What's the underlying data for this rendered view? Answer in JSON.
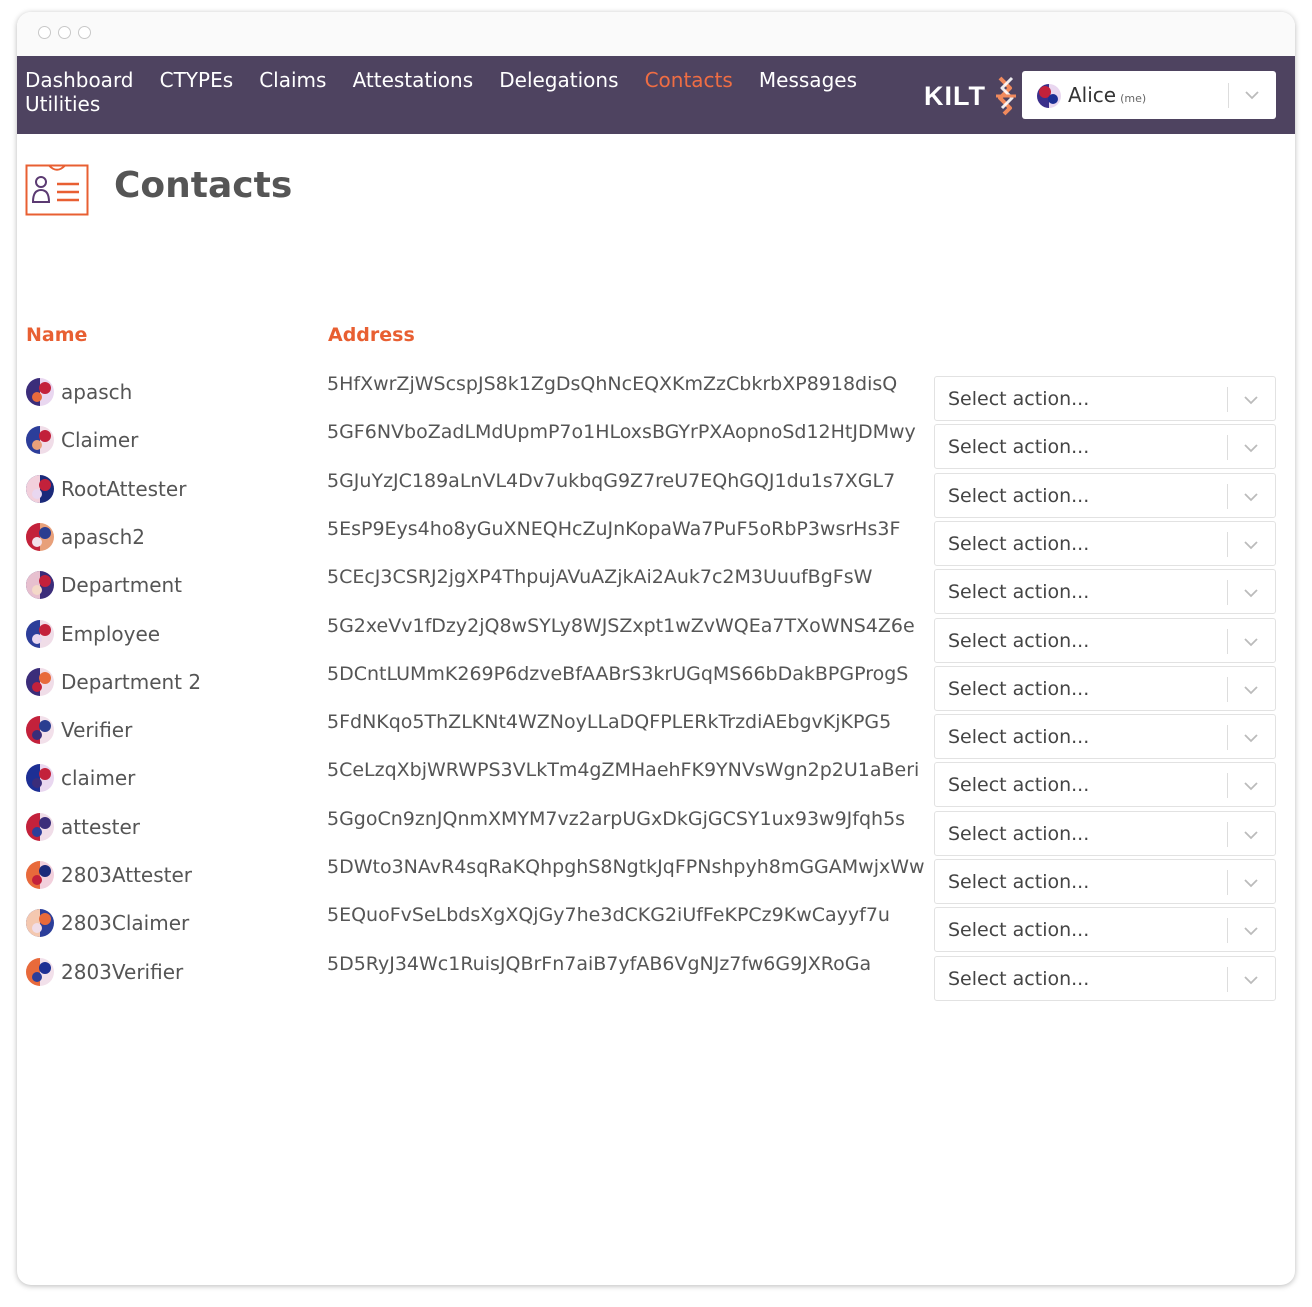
{
  "nav": {
    "links": [
      "Dashboard",
      "CTYPEs",
      "Claims",
      "Attestations",
      "Delegations",
      "Contacts",
      "Messages",
      "Utilities"
    ],
    "active": "Contacts",
    "logo_text": "KILT",
    "user": {
      "name": "Alice",
      "suffix": "(me)"
    }
  },
  "page": {
    "title": "Contacts"
  },
  "table": {
    "headers": {
      "name": "Name",
      "address": "Address"
    },
    "action_placeholder": "Select action...",
    "rows": [
      {
        "name": "apasch",
        "address": "5HfXwrZjWScspJS8k1ZgDsQhNcEQXKmZzCbkrbXP8918disQ"
      },
      {
        "name": "Claimer",
        "address": "5GF6NVboZadLMdUpmP7o1HLoxsBGYrPXAopnoSd12HtJDMwy"
      },
      {
        "name": "RootAttester",
        "address": "5GJuYzJC189aLnVL4Dv7ukbqG9Z7reU7EQhGQJ1du1s7XGL7"
      },
      {
        "name": "apasch2",
        "address": "5EsP9Eys4ho8yGuXNEQHcZuJnKopaWa7PuF5oRbP3wsrHs3F"
      },
      {
        "name": "Department",
        "address": "5CEcJ3CSRJ2jgXP4ThpujAVuAZjkAi2Auk7c2M3UuufBgFsW"
      },
      {
        "name": "Employee",
        "address": "5G2xeVv1fDzy2jQ8wSYLy8WJSZxpt1wZvWQEa7TXoWNS4Z6e"
      },
      {
        "name": "Department 2",
        "address": "5DCntLUMmK269P6dzveBfAABrS3krUGqMS66bDakBPGProgS"
      },
      {
        "name": "Verifier",
        "address": "5FdNKqo5ThZLKNt4WZNoyLLaDQFPLERkTrzdiAEbgvKjKPG5"
      },
      {
        "name": "claimer",
        "address": "5CeLzqXbjWRWPS3VLkTm4gZMHaehFK9YNVsWgn2p2U1aBeri"
      },
      {
        "name": "attester",
        "address": "5GgoCn9znJQnmXMYM7vz2arpUGxDkGjGCSY1ux93w9Jfqh5s"
      },
      {
        "name": "2803Attester",
        "address": "5DWto3NAvR4sqRaKQhpghS8NgtkJqFPNshpyh8mGGAMwjxWw"
      },
      {
        "name": "2803Claimer",
        "address": "5EQuoFvSeLbdsXgXQjGy7he3dCKG2iUfFeKPCz9KwCayyf7u"
      },
      {
        "name": "2803Verifier",
        "address": "5D5RyJ34Wc1RuisJQBrFn7aiB7yfAB6VgNJz7fw6G9JXRoGa"
      }
    ]
  },
  "colors": {
    "navbar": "#4e4360",
    "accent": "#e85f32",
    "active_link": "#ef6d43",
    "text": "#555555"
  },
  "icons": {
    "page_header": "contact-card-icon",
    "chevron": "chevron-down-icon",
    "avatar": "identicon-avatar"
  }
}
